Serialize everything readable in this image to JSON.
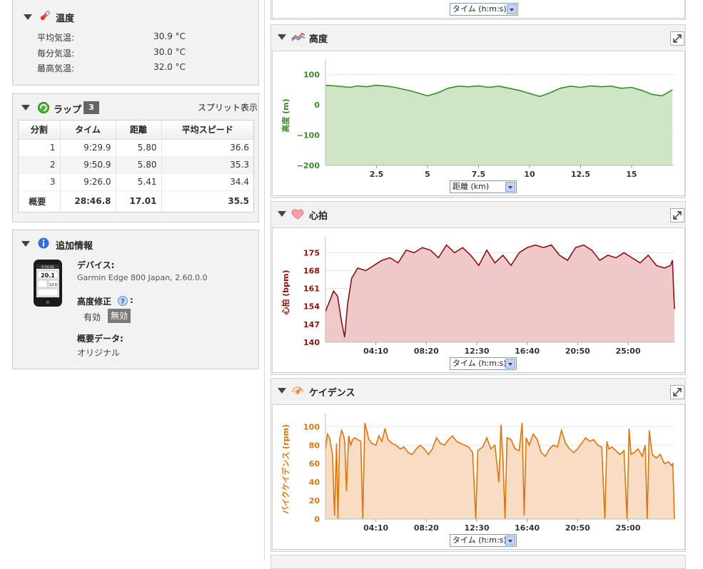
{
  "temperature": {
    "title": "温度",
    "icon": "thermometer-icon",
    "rows": [
      {
        "label": "平均気温:",
        "value": "30.9 °C"
      },
      {
        "label": "毎分気温:",
        "value": "30.0 °C"
      },
      {
        "label": "最高気温:",
        "value": "32.0 °C"
      }
    ]
  },
  "laps": {
    "title": "ラップ",
    "count": "3",
    "split_link": "スプリット表示",
    "headers": [
      "分割",
      "タイム",
      "距離",
      "平均スピード"
    ],
    "rows": [
      {
        "n": "1",
        "time": "9:29.9",
        "dist": "5.80",
        "speed": "36.6"
      },
      {
        "n": "2",
        "time": "9:50.9",
        "dist": "5.80",
        "speed": "35.3"
      },
      {
        "n": "3",
        "time": "9:26.0",
        "dist": "5.41",
        "speed": "34.4"
      }
    ],
    "summary": {
      "label": "概要",
      "time": "28:46.8",
      "dist": "17.01",
      "speed": "35.5"
    }
  },
  "info": {
    "title": "追加情報",
    "device_label": "デバイス:",
    "device_value": "Garmin Edge 800 Japan, 2.60.0.0",
    "elev_label": "高度修正",
    "elev_on": "有効",
    "elev_off": "無効",
    "summary_label": "概要データ:",
    "summary_value": "オリジナル",
    "device_screen": {
      "time": "0:54:02",
      "v1": "20.1",
      "v2": "19.6"
    }
  },
  "top_select": "タイム (h:m:s)",
  "charts": {
    "elevation": {
      "title": "高度",
      "select": "距離 (km)",
      "ylabel": "高度 (m)",
      "color": "#3d8a2a",
      "fill": "#cfe6c6"
    },
    "heart": {
      "title": "心拍",
      "select": "タイム (h:m:s)",
      "ylabel": "心拍 (bpm)",
      "color": "#8b1010",
      "fill": "#efc9c9"
    },
    "cadence": {
      "title": "ケイデンス",
      "select": "タイム (h:m:s)",
      "ylabel": "バイクケイデンス (rpm)",
      "color": "#d9760e",
      "fill": "#f8dcc4"
    }
  },
  "chart_data": [
    {
      "type": "area",
      "ylabel": "高度 (m)",
      "xlabel": "距離 (km)",
      "xlim": [
        0,
        17.1
      ],
      "ylim": [
        -200,
        130
      ],
      "yticks": [
        100,
        0,
        -100,
        -200
      ],
      "xticks": [
        2.5,
        5,
        7.5,
        10,
        12.5,
        15
      ],
      "x": [
        0,
        0.6,
        1.2,
        1.6,
        2.0,
        2.5,
        3.0,
        3.4,
        3.8,
        4.2,
        4.6,
        5.0,
        5.5,
        6.0,
        6.5,
        7.0,
        7.5,
        8.0,
        8.5,
        9.0,
        9.5,
        10.0,
        10.5,
        11.0,
        11.5,
        12.0,
        12.5,
        13.0,
        13.5,
        14.0,
        14.5,
        15.0,
        15.5,
        16.0,
        16.5,
        17.0
      ],
      "y": [
        65,
        62,
        58,
        63,
        60,
        65,
        62,
        58,
        52,
        46,
        38,
        30,
        40,
        55,
        62,
        60,
        63,
        58,
        62,
        55,
        48,
        38,
        28,
        40,
        55,
        62,
        58,
        63,
        60,
        62,
        55,
        58,
        48,
        35,
        30,
        50
      ],
      "grid": true,
      "legend": "none"
    },
    {
      "type": "area",
      "ylabel": "心拍 (bpm)",
      "xlabel": "タイム (h:m:s)",
      "xlim": [
        0,
        1730
      ],
      "ylim": [
        140,
        179
      ],
      "yticks": [
        140,
        147,
        154,
        161,
        168,
        175
      ],
      "xticks": [
        "04:10",
        "08:20",
        "12:30",
        "16:40",
        "20:50",
        "25:00"
      ],
      "xtick_seconds": [
        250,
        500,
        750,
        1000,
        1250,
        1500
      ],
      "x": [
        0,
        20,
        40,
        60,
        80,
        95,
        110,
        130,
        160,
        200,
        240,
        280,
        320,
        360,
        400,
        440,
        480,
        520,
        560,
        600,
        640,
        680,
        720,
        760,
        800,
        840,
        880,
        920,
        960,
        1000,
        1040,
        1080,
        1120,
        1160,
        1200,
        1240,
        1280,
        1320,
        1360,
        1400,
        1440,
        1480,
        1520,
        1560,
        1600,
        1640,
        1680,
        1710,
        1720,
        1726,
        1730
      ],
      "y": [
        152,
        156,
        160,
        158,
        148,
        142,
        155,
        165,
        169,
        168,
        170,
        172,
        173,
        171,
        176,
        175,
        177,
        176,
        173,
        178,
        175,
        177,
        174,
        170,
        176,
        171,
        174,
        170,
        175,
        177,
        178,
        177,
        178,
        174,
        172,
        177,
        178,
        176,
        172,
        174,
        173,
        175,
        173,
        171,
        174,
        170,
        169,
        170,
        172,
        160,
        153
      ],
      "grid": true,
      "legend": "none"
    },
    {
      "type": "area",
      "ylabel": "バイクケイデンス (rpm)",
      "xlabel": "タイム (h:m:s)",
      "xlim": [
        0,
        1730
      ],
      "ylim": [
        0,
        108
      ],
      "yticks": [
        0,
        20,
        40,
        60,
        80,
        100
      ],
      "xticks": [
        "04:10",
        "08:20",
        "12:30",
        "16:40",
        "20:50",
        "25:00"
      ],
      "xtick_seconds": [
        250,
        500,
        750,
        1000,
        1250,
        1500
      ],
      "x": [
        0,
        10,
        20,
        35,
        45,
        55,
        62,
        70,
        80,
        88,
        96,
        104,
        115,
        125,
        135,
        145,
        160,
        175,
        185,
        195,
        205,
        215,
        230,
        250,
        265,
        280,
        295,
        310,
        330,
        350,
        370,
        390,
        410,
        430,
        450,
        470,
        490,
        510,
        530,
        550,
        570,
        590,
        610,
        630,
        650,
        670,
        690,
        710,
        730,
        745,
        755,
        765,
        780,
        800,
        820,
        840,
        860,
        870,
        880,
        890,
        900,
        920,
        940,
        960,
        975,
        985,
        995,
        1010,
        1030,
        1050,
        1070,
        1090,
        1110,
        1130,
        1150,
        1170,
        1190,
        1210,
        1230,
        1250,
        1270,
        1290,
        1310,
        1330,
        1350,
        1370,
        1385,
        1395,
        1405,
        1420,
        1440,
        1460,
        1480,
        1495,
        1505,
        1515,
        1530,
        1550,
        1570,
        1585,
        1595,
        1605,
        1620,
        1640,
        1660,
        1680,
        1700,
        1715,
        1722,
        1730
      ],
      "y": [
        76,
        92,
        88,
        70,
        4,
        82,
        0,
        86,
        96,
        92,
        84,
        30,
        90,
        80,
        86,
        88,
        86,
        84,
        0,
        104,
        96,
        86,
        82,
        80,
        90,
        84,
        98,
        86,
        82,
        80,
        76,
        78,
        72,
        70,
        76,
        80,
        76,
        70,
        76,
        88,
        82,
        80,
        86,
        90,
        84,
        82,
        80,
        78,
        72,
        0,
        74,
        76,
        78,
        88,
        76,
        80,
        40,
        102,
        66,
        0,
        88,
        86,
        76,
        74,
        104,
        4,
        88,
        80,
        92,
        86,
        72,
        68,
        76,
        80,
        78,
        96,
        82,
        76,
        72,
        76,
        82,
        88,
        84,
        86,
        80,
        78,
        0,
        84,
        76,
        78,
        74,
        70,
        74,
        0,
        98,
        70,
        72,
        76,
        68,
        80,
        0,
        96,
        70,
        66,
        70,
        60,
        62,
        58,
        60,
        0
      ],
      "grid": true,
      "legend": "none"
    }
  ]
}
